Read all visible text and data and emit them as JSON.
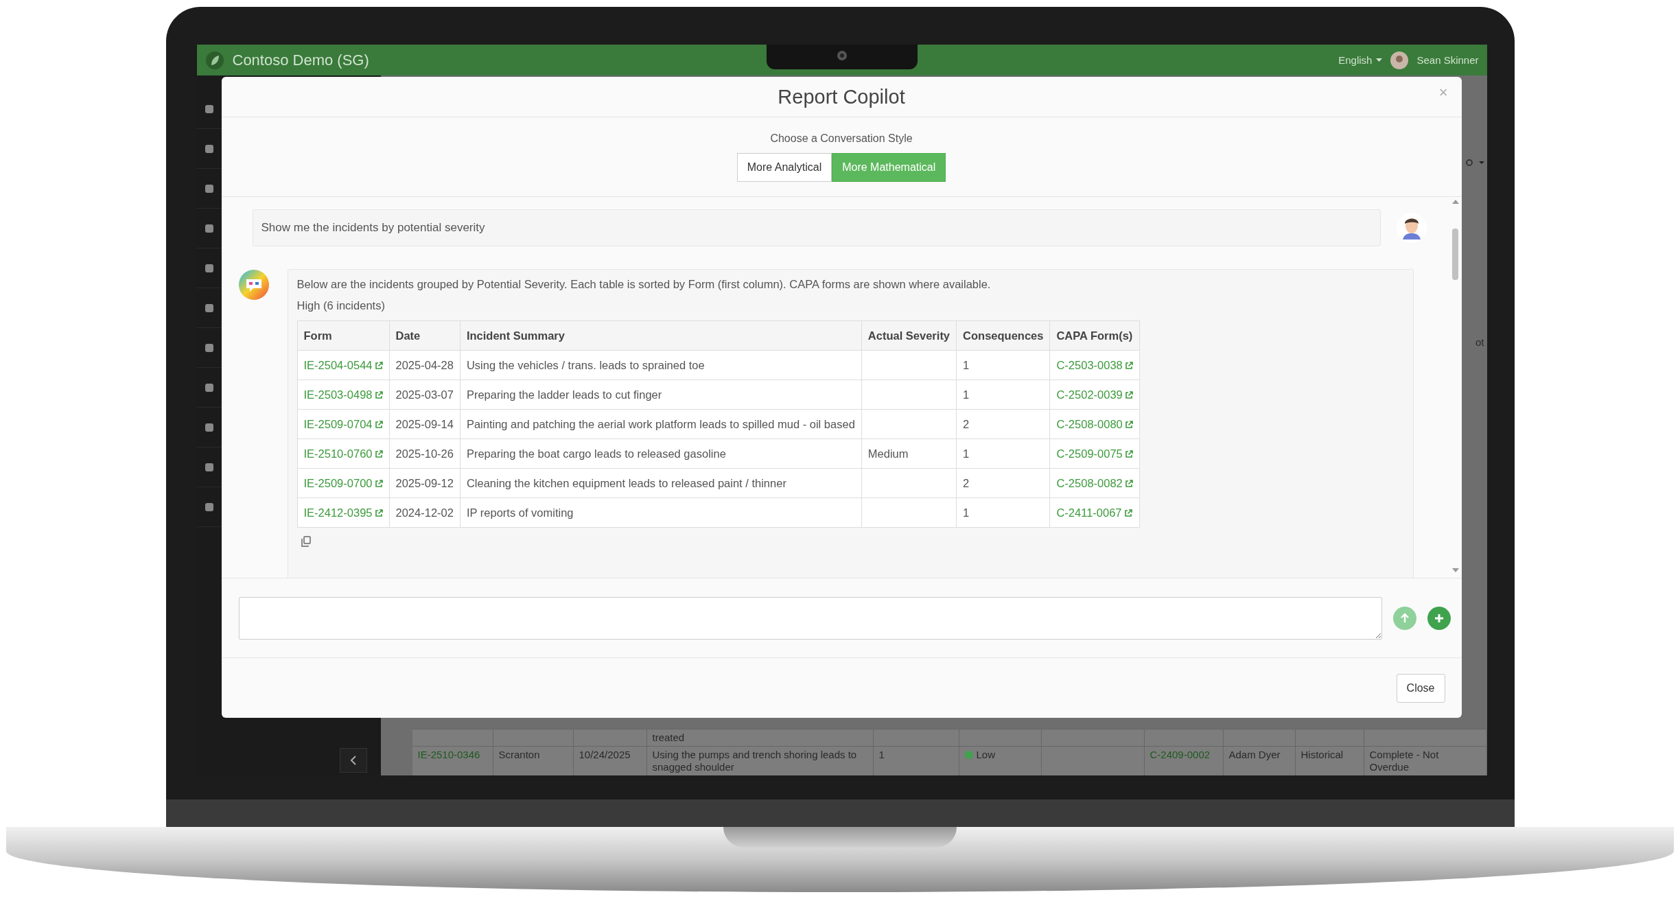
{
  "app_header": {
    "title": "Contoso Demo (SG)",
    "language": "English",
    "user": "Sean Skinner"
  },
  "background_table": {
    "right_edge_text": "ot",
    "rows": [
      {
        "summary": "treated"
      },
      {
        "form": "IE-2510-0346",
        "site": "Scranton",
        "date": "10/24/2025",
        "summary": "Using the pumps and trench shoring leads to snagged shoulder",
        "consequences": "1",
        "severity": {
          "text": "Low",
          "color": "#3fa34d"
        },
        "capa": "C-2409-0002",
        "owner": "Adam Dyer",
        "type": "Historical",
        "status": "Complete - Not Overdue"
      }
    ]
  },
  "modal": {
    "title": "Report Copilot",
    "close_glyph": "×",
    "style_prompt": "Choose a Conversation Style",
    "styles": [
      {
        "label": "More Analytical",
        "selected": false
      },
      {
        "label": "More Mathematical",
        "selected": true
      }
    ],
    "messages": [
      {
        "kind": "user",
        "text": "Show me the incidents by potential severity"
      },
      {
        "kind": "bot",
        "intro": "Below are the incidents grouped by Potential Severity. Each table is sorted by Form (first column). CAPA forms are shown where available.",
        "group_title": "High (6 incidents)",
        "table": {
          "columns": [
            "Form",
            "Date",
            "Incident Summary",
            "Actual Severity",
            "Consequences",
            "CAPA Form(s)"
          ],
          "rows": [
            {
              "form": "IE-2504-0544",
              "date": "2025-04-28",
              "summary": "Using the vehicles / trans. leads to sprained toe",
              "consequences": "1",
              "capa": "C-2503-0038"
            },
            {
              "form": "IE-2503-0498",
              "date": "2025-03-07",
              "summary": "Preparing the ladder leads to cut finger",
              "consequences": "1",
              "capa": "C-2502-0039"
            },
            {
              "form": "IE-2509-0704",
              "date": "2025-09-14",
              "summary": "Painting and patching the aerial work platform leads to spilled mud - oil based",
              "consequences": "2",
              "capa": "C-2508-0080"
            },
            {
              "form": "IE-2510-0760",
              "date": "2025-10-26",
              "summary": "Preparing the boat cargo leads to released gasoline",
              "actual_severity": "Medium",
              "consequences": "1",
              "capa": "C-2509-0075"
            },
            {
              "form": "IE-2509-0700",
              "date": "2025-09-12",
              "summary": "Cleaning the kitchen equipment leads to released paint / thinner",
              "consequences": "2",
              "capa": "C-2508-0082"
            },
            {
              "form": "IE-2412-0395",
              "date": "2024-12-02",
              "summary": "IP reports of vomiting",
              "consequences": "1",
              "capa": "C-2411-0067"
            }
          ]
        }
      }
    ],
    "input_actions": [
      {
        "kind": "send",
        "disabled": true
      },
      {
        "kind": "add",
        "disabled": false
      }
    ],
    "footer_button": "Close"
  }
}
